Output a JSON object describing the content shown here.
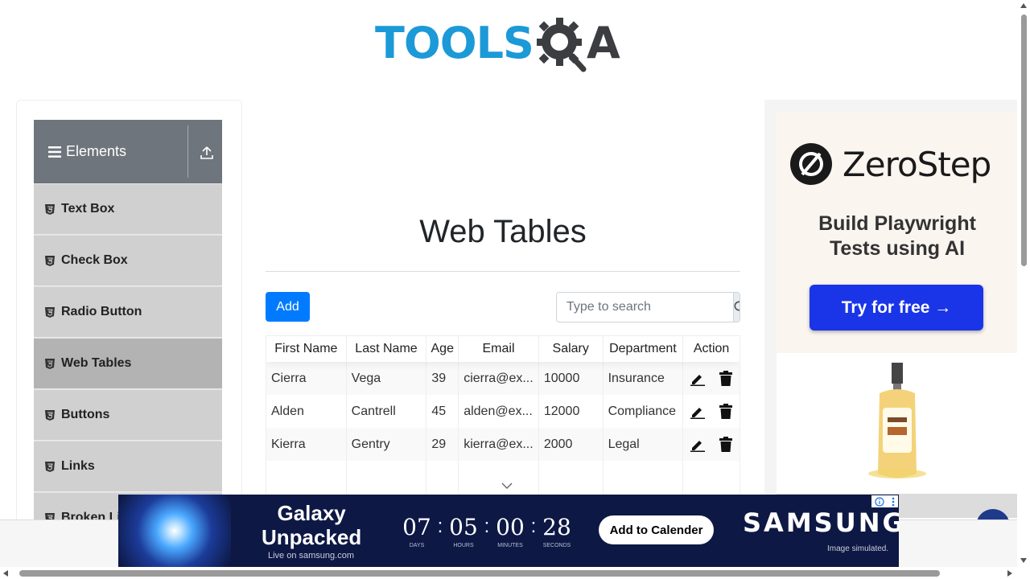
{
  "logo": {
    "part1": "TOOLS",
    "part2": "A"
  },
  "sidebar": {
    "group_title": "Elements",
    "items": [
      {
        "label": "Text Box"
      },
      {
        "label": "Check Box"
      },
      {
        "label": "Radio Button"
      },
      {
        "label": "Web Tables",
        "active": true
      },
      {
        "label": "Buttons"
      },
      {
        "label": "Links"
      },
      {
        "label": "Broken Links - Images"
      }
    ]
  },
  "main": {
    "title": "Web Tables",
    "add_label": "Add",
    "search_placeholder": "Type to search"
  },
  "table": {
    "headers": [
      "First Name",
      "Last Name",
      "Age",
      "Email",
      "Salary",
      "Department",
      "Action"
    ],
    "rows": [
      [
        "Cierra",
        "Vega",
        "39",
        "cierra@ex...",
        "10000",
        "Insurance"
      ],
      [
        "Alden",
        "Cantrell",
        "45",
        "alden@ex...",
        "12000",
        "Compliance"
      ],
      [
        "Kierra",
        "Gentry",
        "29",
        "kierra@ex...",
        "2000",
        "Legal"
      ]
    ]
  },
  "ad_right": {
    "brand": "ZeroStep",
    "tagline_1": "Build Playwright",
    "tagline_2": "Tests using AI",
    "cta": "Try for free →"
  },
  "ad_bottom": {
    "title_1": "Galaxy",
    "title_2": "Unpacked",
    "live": "Live on samsung.com",
    "countdown": [
      {
        "value": "07",
        "label": "DAYS"
      },
      {
        "value": "05",
        "label": "HOURS"
      },
      {
        "value": "00",
        "label": "MINUTES"
      },
      {
        "value": "28",
        "label": "SECONDS"
      }
    ],
    "cta": "Add to Calender",
    "brand": "SAMSUNG",
    "note": "Image simulated."
  },
  "colors": {
    "logo_blue": "#1c99d7",
    "primary": "#007bff",
    "sidebar_header": "#6e757c",
    "zerostep_button": "#1a35e8",
    "samsung_bg": "#0d1844"
  }
}
